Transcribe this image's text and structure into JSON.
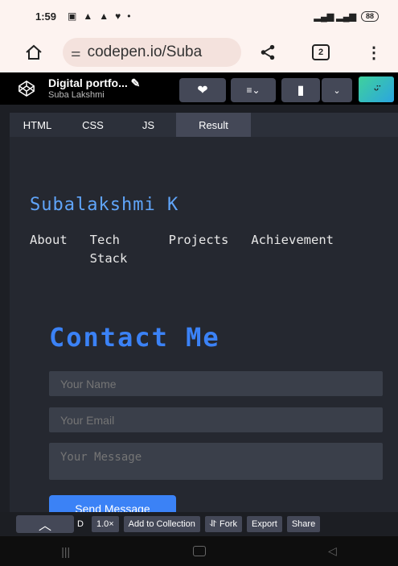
{
  "status_bar": {
    "time": "1:59",
    "battery": "88"
  },
  "browser": {
    "url": "codepen.io/Suba",
    "tab_count": "2"
  },
  "codepen": {
    "title": "Digital portfo...",
    "author": "Suba Lakshmi"
  },
  "editor_tabs": [
    "HTML",
    "CSS",
    "JS",
    "Result"
  ],
  "result": {
    "name": "Subalakshmi K",
    "nav": [
      "About",
      "Tech Stack",
      "Projects",
      "Achievement"
    ],
    "contact_title": "Contact Me",
    "name_placeholder": "Your Name",
    "email_placeholder": "Your Email",
    "message_placeholder": "Your Message",
    "send_label": "Send Message"
  },
  "footer": {
    "d_label": "D",
    "zoom": "1.0×",
    "add_collection": "Add to Collection",
    "fork": "Fork",
    "export": "Export",
    "share": "Share"
  }
}
